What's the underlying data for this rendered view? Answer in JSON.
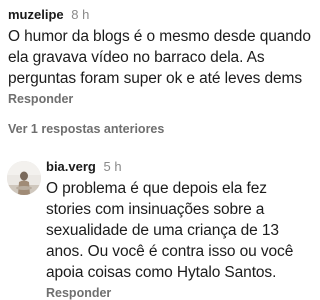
{
  "comments": [
    {
      "username": "muzelipe",
      "time": "8 h",
      "lines": [
        "O humor da blogs é o mesmo desde quando",
        "ela gravava vídeo no barraco dela. As",
        "perguntas foram super ok e até leves dems"
      ],
      "reply_label": "Responder"
    }
  ],
  "view_replies_label": "Ver 1 respostas anteriores",
  "reply": {
    "username": "bia.verg",
    "time": "5 h",
    "avatar_icon": "profile-photo",
    "lines": [
      "O problema é que depois ela fez",
      "stories com insinuações sobre a",
      "sexualidade de uma criança de 13",
      "anos. Ou você é contra isso ou você",
      "apoia coisas como Hytalo Santos."
    ],
    "reply_label": "Responder"
  },
  "colors": {
    "text": "#1a1a1a",
    "muted": "#8a8a8a",
    "action": "#6f6f6f",
    "background": "#ffffff"
  }
}
